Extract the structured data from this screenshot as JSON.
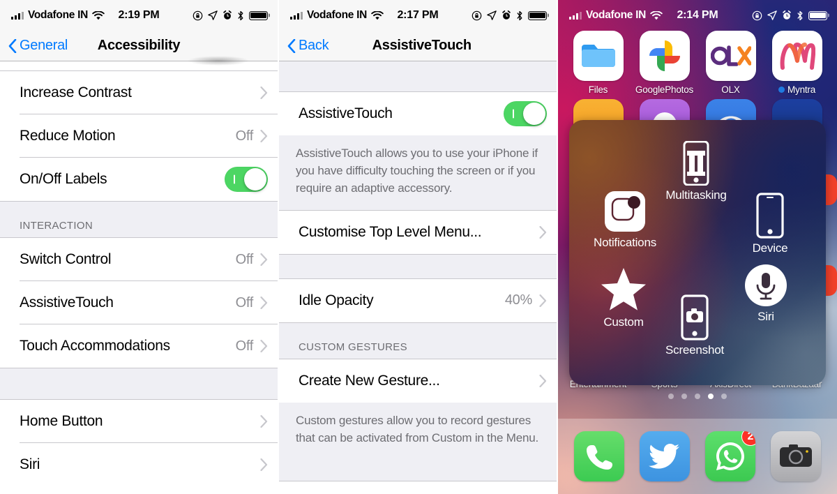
{
  "panels": {
    "accessibility": {
      "statusbar": {
        "carrier": "Vodafone IN",
        "time": "2:19 PM"
      },
      "nav": {
        "back_label": "General",
        "title": "Accessibility"
      },
      "rows": [
        {
          "label": "Increase Contrast",
          "value": "",
          "type": "chevron"
        },
        {
          "label": "Reduce Motion",
          "value": "Off",
          "type": "chevron"
        },
        {
          "label": "On/Off Labels",
          "value": "",
          "type": "toggle",
          "toggle_on": true
        }
      ],
      "section_header": "INTERACTION",
      "interaction_rows": [
        {
          "label": "Switch Control",
          "value": "Off",
          "type": "chevron"
        },
        {
          "label": "AssistiveTouch",
          "value": "Off",
          "type": "chevron"
        },
        {
          "label": "Touch Accommodations",
          "value": "Off",
          "type": "chevron"
        }
      ],
      "bottom_rows": [
        {
          "label": "Home Button",
          "value": "",
          "type": "chevron"
        },
        {
          "label": "Siri",
          "value": "",
          "type": "chevron"
        }
      ]
    },
    "assistivetouch": {
      "statusbar": {
        "carrier": "Vodafone IN",
        "time": "2:17 PM"
      },
      "nav": {
        "back_label": "Back",
        "title": "AssistiveTouch"
      },
      "main_row": {
        "label": "AssistiveTouch",
        "toggle_on": true
      },
      "description": "AssistiveTouch allows you to use your iPhone if you have difficulty touching the screen or if you require an adaptive accessory.",
      "customise_row": {
        "label": "Customise Top Level Menu...",
        "value": ""
      },
      "idle_opacity_row": {
        "label": "Idle Opacity",
        "value": "40%"
      },
      "gestures_header": "CUSTOM GESTURES",
      "create_gesture_row": {
        "label": "Create New Gesture...",
        "value": ""
      },
      "gestures_note": "Custom gestures allow you to record gestures that can be activated from Custom in the Menu."
    },
    "homescreen": {
      "statusbar": {
        "carrier": "Vodafone IN",
        "time": "2:14 PM"
      },
      "apps_row1": [
        {
          "label": "Files",
          "icon": "files-icon",
          "new": false
        },
        {
          "label": "GooglePhotos",
          "icon": "google-photos-icon",
          "new": false
        },
        {
          "label": "OLX",
          "icon": "olx-icon",
          "new": false
        },
        {
          "label": "Myntra",
          "icon": "myntra-icon",
          "new": true
        }
      ],
      "apps_row_bottom": [
        {
          "label": "Entertainment",
          "icon": "entertainment-folder-icon"
        },
        {
          "label": "Sports",
          "icon": "sports-folder-icon"
        },
        {
          "label": "AxisDirect",
          "icon": "axisdirect-icon"
        },
        {
          "label": "BankBazaar",
          "icon": "bankbazaar-icon"
        }
      ],
      "page_dots": {
        "count": 5,
        "active_index": 3
      },
      "dock": [
        {
          "label": "Phone",
          "icon": "phone-icon",
          "badge": ""
        },
        {
          "label": "Twitter",
          "icon": "twitter-icon",
          "badge": ""
        },
        {
          "label": "WhatsApp",
          "icon": "whatsapp-icon",
          "badge": "2"
        },
        {
          "label": "Camera",
          "icon": "camera-icon",
          "badge": ""
        }
      ],
      "assistive_menu": [
        {
          "label": "Multitasking",
          "icon": "multitasking-icon"
        },
        {
          "label": "Notifications",
          "icon": "notifications-icon"
        },
        {
          "label": "Device",
          "icon": "device-icon"
        },
        {
          "label": "Custom",
          "icon": "star-icon"
        },
        {
          "label": "Screenshot",
          "icon": "screenshot-icon"
        },
        {
          "label": "Siri",
          "icon": "siri-microphone-icon"
        }
      ]
    }
  },
  "colors": {
    "accent_blue": "#007aff",
    "toggle_green": "#4cd663",
    "group_bg": "#efeff4",
    "separator": "#c8c7cc",
    "value_gray": "#8e8e93",
    "badge_red": "#fc3126"
  }
}
